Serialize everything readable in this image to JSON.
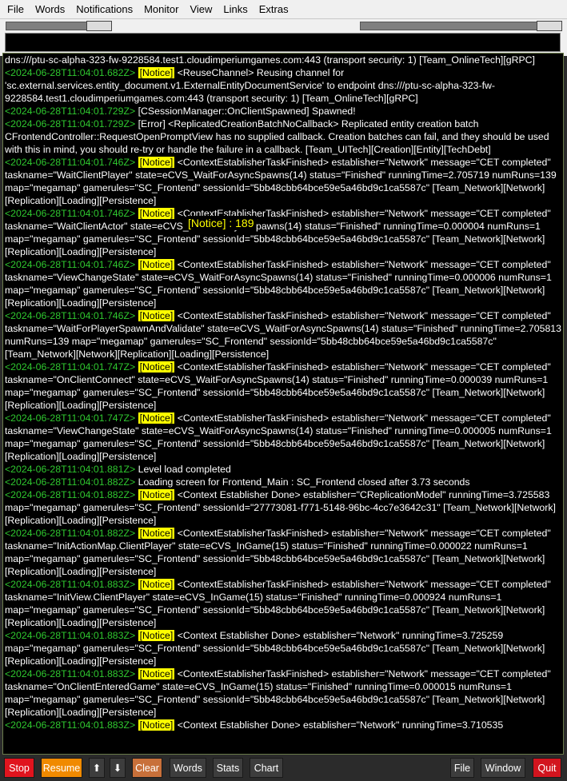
{
  "menu": [
    "File",
    "Words",
    "Notifications",
    "Monitor",
    "View",
    "Links",
    "Extras"
  ],
  "command_input": {
    "value": ""
  },
  "overlay": {
    "text": "[Notice] : 189"
  },
  "log": [
    [
      {
        "t": "text",
        "v": "dns:///ptu-sc-alpha-323-fw-9228584.test1.cloudimperiumgames.com:443 (transport security: 1) [Team_OnlineTech][gRPC]"
      }
    ],
    [
      {
        "t": "ts",
        "v": "<2024-06-28T11:04:01.682Z>"
      },
      {
        "t": "text",
        "v": " "
      },
      {
        "t": "notice",
        "v": "[Notice]"
      },
      {
        "t": "text",
        "v": " <ReuseChannel> Reusing channel for 'sc.external.services.entity_document.v1.ExternalEntityDocumentService' to endpoint dns:///ptu-sc-alpha-323-fw-9228584.test1.cloudimperiumgames.com:443 (transport security: 1) [Team_OnlineTech][gRPC]"
      }
    ],
    [
      {
        "t": "ts",
        "v": "<2024-06-28T11:04:01.729Z>"
      },
      {
        "t": "text",
        "v": " [CSessionManager::OnClientSpawned] Spawned!"
      }
    ],
    [
      {
        "t": "ts",
        "v": "<2024-06-28T11:04:01.729Z>"
      },
      {
        "t": "text",
        "v": " [Error] <ReplicatedCreationBatchNoCallback> Replicated entity creation batch CFrontendController::RequestOpenPromptView has no supplied callback. Creation batches can fail, and they should be used with this in mind, you should re-try or handle the failure in a callback. [Team_UITech][Creation][Entity][TechDebt]"
      }
    ],
    [
      {
        "t": "ts",
        "v": "<2024-06-28T11:04:01.746Z>"
      },
      {
        "t": "text",
        "v": " "
      },
      {
        "t": "notice",
        "v": "[Notice]"
      },
      {
        "t": "text",
        "v": " <ContextEstablisherTaskFinished> establisher=\"Network\" message=\"CET completed\" taskname=\"WaitClientPlayer\" state=eCVS_WaitForAsyncSpawns(14) status=\"Finished\" runningTime=2.705719 numRuns=139 map=\"megamap\" gamerules=\"SC_Frontend\" sessionId=\"5bb48cbb64bce59e5a46bd9c1ca5587c\" [Team_Network][Network][Replication][Loading][Persistence]"
      }
    ],
    [
      {
        "t": "ts",
        "v": "<2024-06-28T11:04:01.746Z>"
      },
      {
        "t": "text",
        "v": " "
      },
      {
        "t": "notice",
        "v": "[Notice]"
      },
      {
        "t": "text",
        "v": " <ContextEstablisherTaskFinished> establisher=\"Network\" message=\"CET completed\" taskname=\"WaitClientActor\" state=eCVS_WaitForAsyncSpawns(14) status=\"Finished\" runningTime=0.000004 numRuns=1 map=\"megamap\" gamerules=\"SC_Frontend\" sessionId=\"5bb48cbb64bce59e5a46bd9c1ca5587c\" [Team_Network][Network][Replication][Loading][Persistence]"
      }
    ],
    [
      {
        "t": "ts",
        "v": "<2024-06-28T11:04:01.746Z>"
      },
      {
        "t": "text",
        "v": " "
      },
      {
        "t": "notice",
        "v": "[Notice]"
      },
      {
        "t": "text",
        "v": " <ContextEstablisherTaskFinished> establisher=\"Network\" message=\"CET completed\" taskname=\"ViewChangeState\" state=eCVS_WaitForAsyncSpawns(14) status=\"Finished\" runningTime=0.000006 numRuns=1 map=\"megamap\" gamerules=\"SC_Frontend\" sessionId=\"5bb48cbb64bce59e5a46bd9c1ca5587c\" [Team_Network][Network][Replication][Loading][Persistence]"
      }
    ],
    [
      {
        "t": "ts",
        "v": "<2024-06-28T11:04:01.746Z>"
      },
      {
        "t": "text",
        "v": " "
      },
      {
        "t": "notice",
        "v": "[Notice]"
      },
      {
        "t": "text",
        "v": " <ContextEstablisherTaskFinished> establisher=\"Network\" message=\"CET completed\" taskname=\"WaitForPlayerSpawnAndValidate\" state=eCVS_WaitForAsyncSpawns(14) status=\"Finished\" runningTime=2.705813 numRuns=139 map=\"megamap\" gamerules=\"SC_Frontend\" sessionId=\"5bb48cbb64bce59e5a46bd9c1ca5587c\" [Team_Network][Network][Replication][Loading][Persistence]"
      }
    ],
    [
      {
        "t": "ts",
        "v": "<2024-06-28T11:04:01.747Z>"
      },
      {
        "t": "text",
        "v": " "
      },
      {
        "t": "notice",
        "v": "[Notice]"
      },
      {
        "t": "text",
        "v": " <ContextEstablisherTaskFinished> establisher=\"Network\" message=\"CET completed\" taskname=\"OnClientConnect\" state=eCVS_WaitForAsyncSpawns(14) status=\"Finished\" runningTime=0.000039 numRuns=1 map=\"megamap\" gamerules=\"SC_Frontend\" sessionId=\"5bb48cbb64bce59e5a46bd9c1ca5587c\" [Team_Network][Network][Replication][Loading][Persistence]"
      }
    ],
    [
      {
        "t": "ts",
        "v": "<2024-06-28T11:04:01.747Z>"
      },
      {
        "t": "text",
        "v": " "
      },
      {
        "t": "notice",
        "v": "[Notice]"
      },
      {
        "t": "text",
        "v": " <ContextEstablisherTaskFinished> establisher=\"Network\" message=\"CET completed\" taskname=\"ViewChangeState\" state=eCVS_WaitForAsyncSpawns(14) status=\"Finished\" runningTime=0.000005 numRuns=1 map=\"megamap\" gamerules=\"SC_Frontend\" sessionId=\"5bb48cbb64bce59e5a46bd9c1ca5587c\" [Team_Network][Network][Replication][Loading][Persistence]"
      }
    ],
    [
      {
        "t": "ts",
        "v": "<2024-06-28T11:04:01.881Z>"
      },
      {
        "t": "text",
        "v": " Level load completed"
      }
    ],
    [
      {
        "t": "ts",
        "v": "<2024-06-28T11:04:01.882Z>"
      },
      {
        "t": "text",
        "v": " Loading screen for Frontend_Main : SC_Frontend closed after 3.73 seconds"
      }
    ],
    [
      {
        "t": "ts",
        "v": "<2024-06-28T11:04:01.882Z>"
      },
      {
        "t": "text",
        "v": " "
      },
      {
        "t": "notice",
        "v": "[Notice]"
      },
      {
        "t": "text",
        "v": " <Context Establisher Done> establisher=\"CReplicationModel\" runningTime=3.725583 map=\"megamap\" gamerules=\"SC_Frontend\" sessionId=\"27773081-f771-5148-96bc-4cc7e3642c31\" [Team_Network][Network][Replication][Loading][Persistence]"
      }
    ],
    [
      {
        "t": "ts",
        "v": "<2024-06-28T11:04:01.882Z>"
      },
      {
        "t": "text",
        "v": " "
      },
      {
        "t": "notice",
        "v": "[Notice]"
      },
      {
        "t": "text",
        "v": " <ContextEstablisherTaskFinished> establisher=\"Network\" message=\"CET completed\" taskname=\"InitActionMap.ClientPlayer\" state=eCVS_InGame(15) status=\"Finished\" runningTime=0.000022 numRuns=1 map=\"megamap\" gamerules=\"SC_Frontend\" sessionId=\"5bb48cbb64bce59e5a46bd9c1ca5587c\" [Team_Network][Network][Replication][Loading][Persistence]"
      }
    ],
    [
      {
        "t": "ts",
        "v": "<2024-06-28T11:04:01.883Z>"
      },
      {
        "t": "text",
        "v": " "
      },
      {
        "t": "notice",
        "v": "[Notice]"
      },
      {
        "t": "text",
        "v": " <ContextEstablisherTaskFinished> establisher=\"Network\" message=\"CET completed\" taskname=\"InitView.ClientPlayer\" state=eCVS_InGame(15) status=\"Finished\" runningTime=0.000924 numRuns=1 map=\"megamap\" gamerules=\"SC_Frontend\" sessionId=\"5bb48cbb64bce59e5a46bd9c1ca5587c\" [Team_Network][Network][Replication][Loading][Persistence]"
      }
    ],
    [
      {
        "t": "ts",
        "v": "<2024-06-28T11:04:01.883Z>"
      },
      {
        "t": "text",
        "v": " "
      },
      {
        "t": "notice",
        "v": "[Notice]"
      },
      {
        "t": "text",
        "v": " <Context Establisher Done> establisher=\"Network\" runningTime=3.725259 map=\"megamap\" gamerules=\"SC_Frontend\" sessionId=\"5bb48cbb64bce59e5a46bd9c1ca5587c\" [Team_Network][Network][Replication][Loading][Persistence]"
      }
    ],
    [
      {
        "t": "ts",
        "v": "<2024-06-28T11:04:01.883Z>"
      },
      {
        "t": "text",
        "v": " "
      },
      {
        "t": "notice",
        "v": "[Notice]"
      },
      {
        "t": "text",
        "v": " <ContextEstablisherTaskFinished> establisher=\"Network\" message=\"CET completed\" taskname=\"OnClientEnteredGame\" state=eCVS_InGame(15) status=\"Finished\" runningTime=0.000015 numRuns=1 map=\"megamap\" gamerules=\"SC_Frontend\" sessionId=\"5bb48cbb64bce59e5a46bd9c1ca5587c\" [Team_Network][Network][Replication][Loading][Persistence]"
      }
    ],
    [
      {
        "t": "ts",
        "v": "<2024-06-28T11:04:01.883Z>"
      },
      {
        "t": "text",
        "v": " "
      },
      {
        "t": "notice",
        "v": "[Notice]"
      },
      {
        "t": "text",
        "v": " <Context Establisher Done> establisher=\"Network\" runningTime=3.710535"
      }
    ]
  ],
  "buttons": {
    "stop": "Stop",
    "resume": "Resume",
    "up": "⬆",
    "down": "⬇",
    "clear": "Clear",
    "words": "Words",
    "stats": "Stats",
    "chart": "Chart",
    "file": "File",
    "window": "Window",
    "quit": "Quit"
  },
  "colors": {
    "timestamp": "#2fc82f",
    "notice_bg": "#ffff00",
    "stop": "#e0141e",
    "resume": "#f08a00",
    "clear": "#c8703a",
    "quit": "#d2141e"
  }
}
